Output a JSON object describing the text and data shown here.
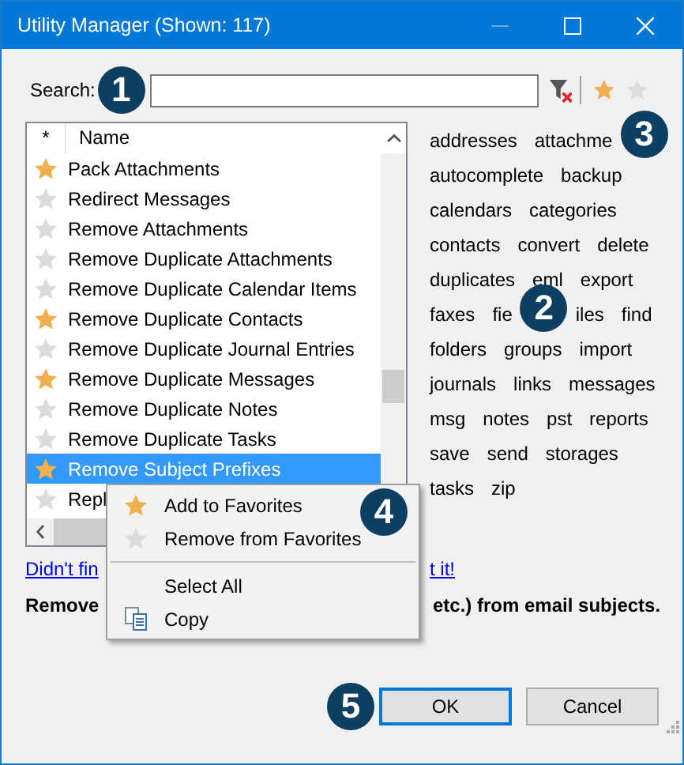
{
  "window": {
    "title": "Utility Manager (Shown: 117)"
  },
  "search": {
    "label": "Search:",
    "callout": "1"
  },
  "list": {
    "columns": [
      "*",
      "Name"
    ],
    "rows": [
      {
        "name": "Pack Attachments",
        "favorite": true,
        "selected": false
      },
      {
        "name": "Redirect Messages",
        "favorite": false,
        "selected": false
      },
      {
        "name": "Remove Attachments",
        "favorite": false,
        "selected": false
      },
      {
        "name": "Remove Duplicate Attachments",
        "favorite": false,
        "selected": false
      },
      {
        "name": "Remove Duplicate Calendar Items",
        "favorite": false,
        "selected": false
      },
      {
        "name": "Remove Duplicate Contacts",
        "favorite": true,
        "selected": false
      },
      {
        "name": "Remove Duplicate Journal Entries",
        "favorite": false,
        "selected": false
      },
      {
        "name": "Remove Duplicate Messages",
        "favorite": true,
        "selected": false
      },
      {
        "name": "Remove Duplicate Notes",
        "favorite": false,
        "selected": false
      },
      {
        "name": "Remove Duplicate Tasks",
        "favorite": false,
        "selected": false
      },
      {
        "name": "Remove Subject Prefixes",
        "favorite": true,
        "selected": true
      },
      {
        "name": "Repl",
        "favorite": false,
        "selected": false
      }
    ]
  },
  "tag_rows": [
    [
      {
        "kind": "tag",
        "text": "addresses"
      },
      {
        "kind": "tag",
        "text": "attachme"
      },
      {
        "kind": "callout",
        "text": "3"
      }
    ],
    [
      {
        "kind": "tag",
        "text": "autocomplete"
      },
      {
        "kind": "tag",
        "text": "backup"
      }
    ],
    [
      {
        "kind": "tag",
        "text": "calendars"
      },
      {
        "kind": "tag",
        "text": "categories"
      }
    ],
    [
      {
        "kind": "tag",
        "text": "contacts"
      },
      {
        "kind": "tag",
        "text": "convert"
      },
      {
        "kind": "tag",
        "text": "delete"
      }
    ],
    [
      {
        "kind": "tag",
        "text": "duplicates"
      },
      {
        "kind": "tag",
        "text": "eml"
      },
      {
        "kind": "tag",
        "text": "export"
      }
    ],
    [
      {
        "kind": "tag",
        "text": "faxes"
      },
      {
        "kind": "tag",
        "text": "fie"
      },
      {
        "kind": "callout",
        "text": "2"
      },
      {
        "kind": "tag",
        "text": "iles"
      },
      {
        "kind": "tag",
        "text": "find"
      }
    ],
    [
      {
        "kind": "tag",
        "text": "folders"
      },
      {
        "kind": "tag",
        "text": "groups"
      },
      {
        "kind": "tag",
        "text": "import"
      }
    ],
    [
      {
        "kind": "tag",
        "text": "journals"
      },
      {
        "kind": "tag",
        "text": "links"
      },
      {
        "kind": "tag",
        "text": "messages"
      }
    ],
    [
      {
        "kind": "tag",
        "text": "msg"
      },
      {
        "kind": "tag",
        "text": "notes"
      },
      {
        "kind": "tag",
        "text": "pst"
      },
      {
        "kind": "tag",
        "text": "reports"
      }
    ],
    [
      {
        "kind": "tag",
        "text": "save"
      },
      {
        "kind": "tag",
        "text": "send"
      },
      {
        "kind": "tag",
        "text": "storages"
      }
    ],
    [
      {
        "kind": "tag",
        "text": "tasks"
      },
      {
        "kind": "tag",
        "text": "zip"
      }
    ]
  ],
  "link": {
    "start": "Didn't fin",
    "end": "t it!"
  },
  "description": {
    "start": "Remove",
    "end": "etc.) from email subjects."
  },
  "context_menu": [
    {
      "kind": "starred",
      "label": "Add to Favorites",
      "callout": "4"
    },
    {
      "kind": "unstarred",
      "label": "Remove from Favorites"
    },
    {
      "kind": "separator"
    },
    {
      "kind": "plain",
      "label": "Select All"
    },
    {
      "kind": "copy",
      "label": "Copy"
    }
  ],
  "buttons": [
    {
      "label": "OK",
      "default": true,
      "callout": "5"
    },
    {
      "label": "Cancel",
      "default": false
    }
  ]
}
